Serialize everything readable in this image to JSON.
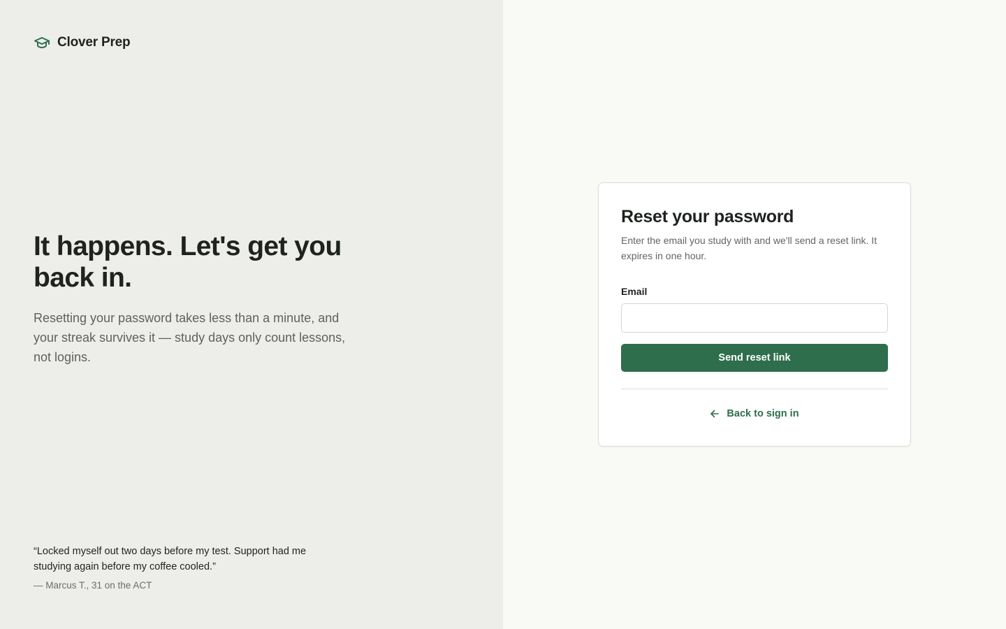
{
  "brand": {
    "name": "Clover Prep",
    "icon": "graduation-cap-icon",
    "color": "#2e6e4c"
  },
  "hero": {
    "title": "It happens. Let's get you back in.",
    "subtitle": "Resetting your password takes less than a minute, and your streak survives it — study days only count lessons, not logins."
  },
  "testimonial": {
    "quote": "“Locked myself out two days before my test. Support had me studying again before my coffee cooled.”",
    "author": "— Marcus T., 31 on the ACT"
  },
  "reset_card": {
    "title": "Reset your password",
    "description": "Enter the email you study with and we'll send a reset link. It expires in one hour.",
    "email_label": "Email",
    "email_value": "",
    "email_placeholder": "",
    "submit_label": "Send reset link",
    "back_label": "Back to sign in",
    "back_icon": "arrow-left-icon"
  },
  "colors": {
    "accent": "#2e6e4c",
    "left_bg": "#ededea",
    "right_bg": "#f9f9f5"
  }
}
